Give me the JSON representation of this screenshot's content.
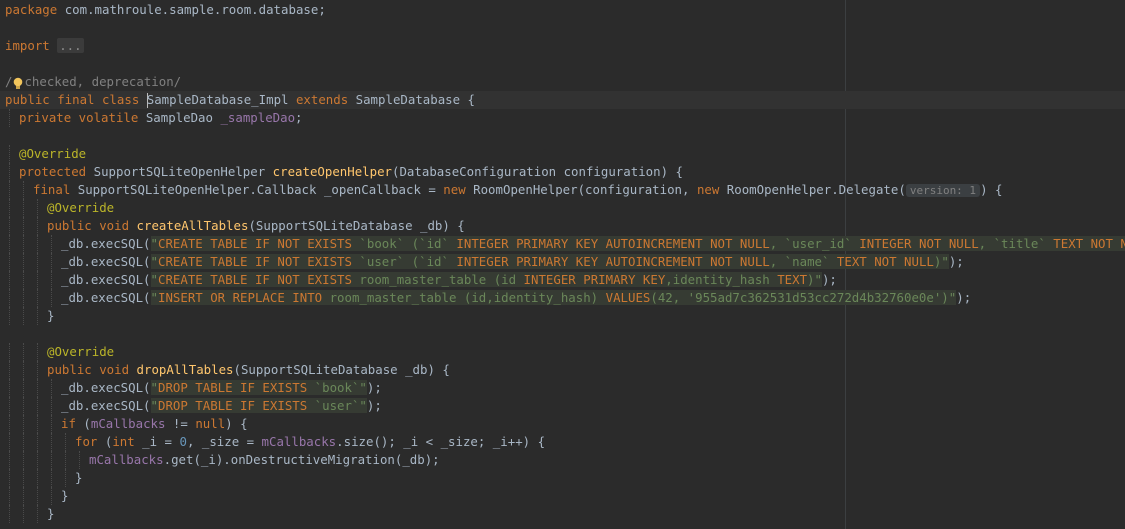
{
  "editor": {
    "lines": [
      {
        "n": 1,
        "tokens": [
          [
            "kw",
            "package "
          ],
          [
            "p",
            "com.mathroule.sample.room.database;"
          ]
        ]
      },
      {
        "n": 2,
        "tokens": []
      },
      {
        "n": 3,
        "tokens": [
          [
            "kw",
            "import "
          ],
          [
            "fold",
            "..."
          ]
        ]
      },
      {
        "n": 4,
        "tokens": []
      },
      {
        "n": 5,
        "tokens": [
          [
            "cmt",
            "/"
          ],
          [
            "bulb",
            ""
          ],
          [
            "cmt",
            "checked, deprecation/"
          ]
        ]
      },
      {
        "n": 6,
        "current": true,
        "tokens": [
          [
            "kw",
            "public final class "
          ],
          [
            "caret",
            ""
          ],
          [
            "p",
            "SampleDatabase_Impl "
          ],
          [
            "kw",
            "extends "
          ],
          [
            "p",
            "SampleDatabase {"
          ]
        ]
      },
      {
        "n": 7,
        "indent": 1,
        "tokens": [
          [
            "kw",
            "private volatile "
          ],
          [
            "p",
            "SampleDao "
          ],
          [
            "fld",
            "_sampleDao"
          ],
          [
            "p",
            ";"
          ]
        ]
      },
      {
        "n": 8,
        "tokens": []
      },
      {
        "n": 9,
        "indent": 1,
        "tokens": [
          [
            "ann",
            "@Override"
          ]
        ]
      },
      {
        "n": 10,
        "indent": 1,
        "tokens": [
          [
            "kw",
            "protected "
          ],
          [
            "p",
            "SupportSQLiteOpenHelper "
          ],
          [
            "fn",
            "createOpenHelper"
          ],
          [
            "p",
            "(DatabaseConfiguration configuration) {"
          ]
        ]
      },
      {
        "n": 11,
        "indent": 2,
        "tokens": [
          [
            "kw",
            "final "
          ],
          [
            "p",
            "SupportSQLiteOpenHelper.Callback _openCallback = "
          ],
          [
            "kw",
            "new "
          ],
          [
            "p",
            "RoomOpenHelper(configuration, "
          ],
          [
            "kw",
            "new "
          ],
          [
            "p",
            "RoomOpenHelper.Delegate("
          ],
          [
            "hint",
            "version: 1"
          ],
          [
            "p",
            ") {"
          ]
        ]
      },
      {
        "n": 12,
        "indent": 3,
        "tokens": [
          [
            "ann",
            "@Override"
          ]
        ]
      },
      {
        "n": 13,
        "indent": 3,
        "tokens": [
          [
            "kw",
            "public void "
          ],
          [
            "fn",
            "createAllTables"
          ],
          [
            "p",
            "(SupportSQLiteDatabase _db) {"
          ]
        ]
      },
      {
        "n": 14,
        "indent": 4,
        "tokens": [
          [
            "p",
            "_db.execSQL("
          ],
          [
            "sqlbg",
            "\"CREATE TABLE IF NOT EXISTS `book` (`id` INTEGER PRIMARY KEY AUTOINCREMENT NOT NULL, `user_id` INTEGER NOT NULL, `title` TEXT NOT NULL, FORE"
          ]
        ]
      },
      {
        "n": 15,
        "indent": 4,
        "tokens": [
          [
            "p",
            "_db.execSQL("
          ],
          [
            "sqlbg",
            "\"CREATE TABLE IF NOT EXISTS `user` (`id` INTEGER PRIMARY KEY AUTOINCREMENT NOT NULL, `name` TEXT NOT NULL)\""
          ],
          [
            "p",
            ");"
          ]
        ]
      },
      {
        "n": 16,
        "indent": 4,
        "tokens": [
          [
            "p",
            "_db.execSQL("
          ],
          [
            "sqlbg",
            "\"CREATE TABLE IF NOT EXISTS room_master_table (id INTEGER PRIMARY KEY,identity_hash TEXT)\""
          ],
          [
            "p",
            ");"
          ]
        ]
      },
      {
        "n": 17,
        "indent": 4,
        "tokens": [
          [
            "p",
            "_db.execSQL("
          ],
          [
            "sqlbg",
            "\"INSERT OR REPLACE INTO room_master_table (id,identity_hash) VALUES(42, '955ad7c362531d53cc272d4b32760e0e')\""
          ],
          [
            "p",
            ");"
          ]
        ]
      },
      {
        "n": 18,
        "indent": 3,
        "tokens": [
          [
            "p",
            "}"
          ]
        ]
      },
      {
        "n": 19,
        "tokens": []
      },
      {
        "n": 20,
        "indent": 3,
        "tokens": [
          [
            "ann",
            "@Override"
          ]
        ]
      },
      {
        "n": 21,
        "indent": 3,
        "tokens": [
          [
            "kw",
            "public void "
          ],
          [
            "fn",
            "dropAllTables"
          ],
          [
            "p",
            "(SupportSQLiteDatabase _db) {"
          ]
        ]
      },
      {
        "n": 22,
        "indent": 4,
        "tokens": [
          [
            "p",
            "_db.execSQL("
          ],
          [
            "sqlbg",
            "\"DROP TABLE IF EXISTS `book`\""
          ],
          [
            "p",
            ");"
          ]
        ]
      },
      {
        "n": 23,
        "indent": 4,
        "tokens": [
          [
            "p",
            "_db.execSQL("
          ],
          [
            "sqlbg",
            "\"DROP TABLE IF EXISTS `user`\""
          ],
          [
            "p",
            ");"
          ]
        ]
      },
      {
        "n": 24,
        "indent": 4,
        "tokens": [
          [
            "kw",
            "if "
          ],
          [
            "p",
            "("
          ],
          [
            "fld",
            "mCallbacks "
          ],
          [
            "p",
            "!= "
          ],
          [
            "kw",
            "null"
          ],
          [
            "p",
            ") {"
          ]
        ]
      },
      {
        "n": 25,
        "indent": 5,
        "tokens": [
          [
            "kw",
            "for "
          ],
          [
            "p",
            "("
          ],
          [
            "kw",
            "int "
          ],
          [
            "p",
            "_i = "
          ],
          [
            "num",
            "0"
          ],
          [
            "p",
            ", _size = "
          ],
          [
            "fld",
            "mCallbacks"
          ],
          [
            "p",
            ".size(); _i < _size; _i++) {"
          ]
        ]
      },
      {
        "n": 26,
        "indent": 6,
        "tokens": [
          [
            "fld",
            "mCallbacks"
          ],
          [
            "p",
            ".get(_i).onDestructiveMigration(_db);"
          ]
        ]
      },
      {
        "n": 27,
        "indent": 5,
        "tokens": [
          [
            "p",
            "}"
          ]
        ]
      },
      {
        "n": 28,
        "indent": 4,
        "tokens": [
          [
            "p",
            "}"
          ]
        ]
      },
      {
        "n": 29,
        "indent": 3,
        "tokens": [
          [
            "p",
            "}"
          ]
        ]
      }
    ]
  },
  "colors": {
    "background": "#2b2b2b",
    "keyword": "#cc7832",
    "annotation": "#bbb529",
    "method": "#ffc66d",
    "field": "#9876aa",
    "number": "#6897bb",
    "string": "#6a8759",
    "plain": "#a9b7c6",
    "comment": "#808080"
  },
  "icons": {
    "intention": "lightbulb-icon"
  }
}
